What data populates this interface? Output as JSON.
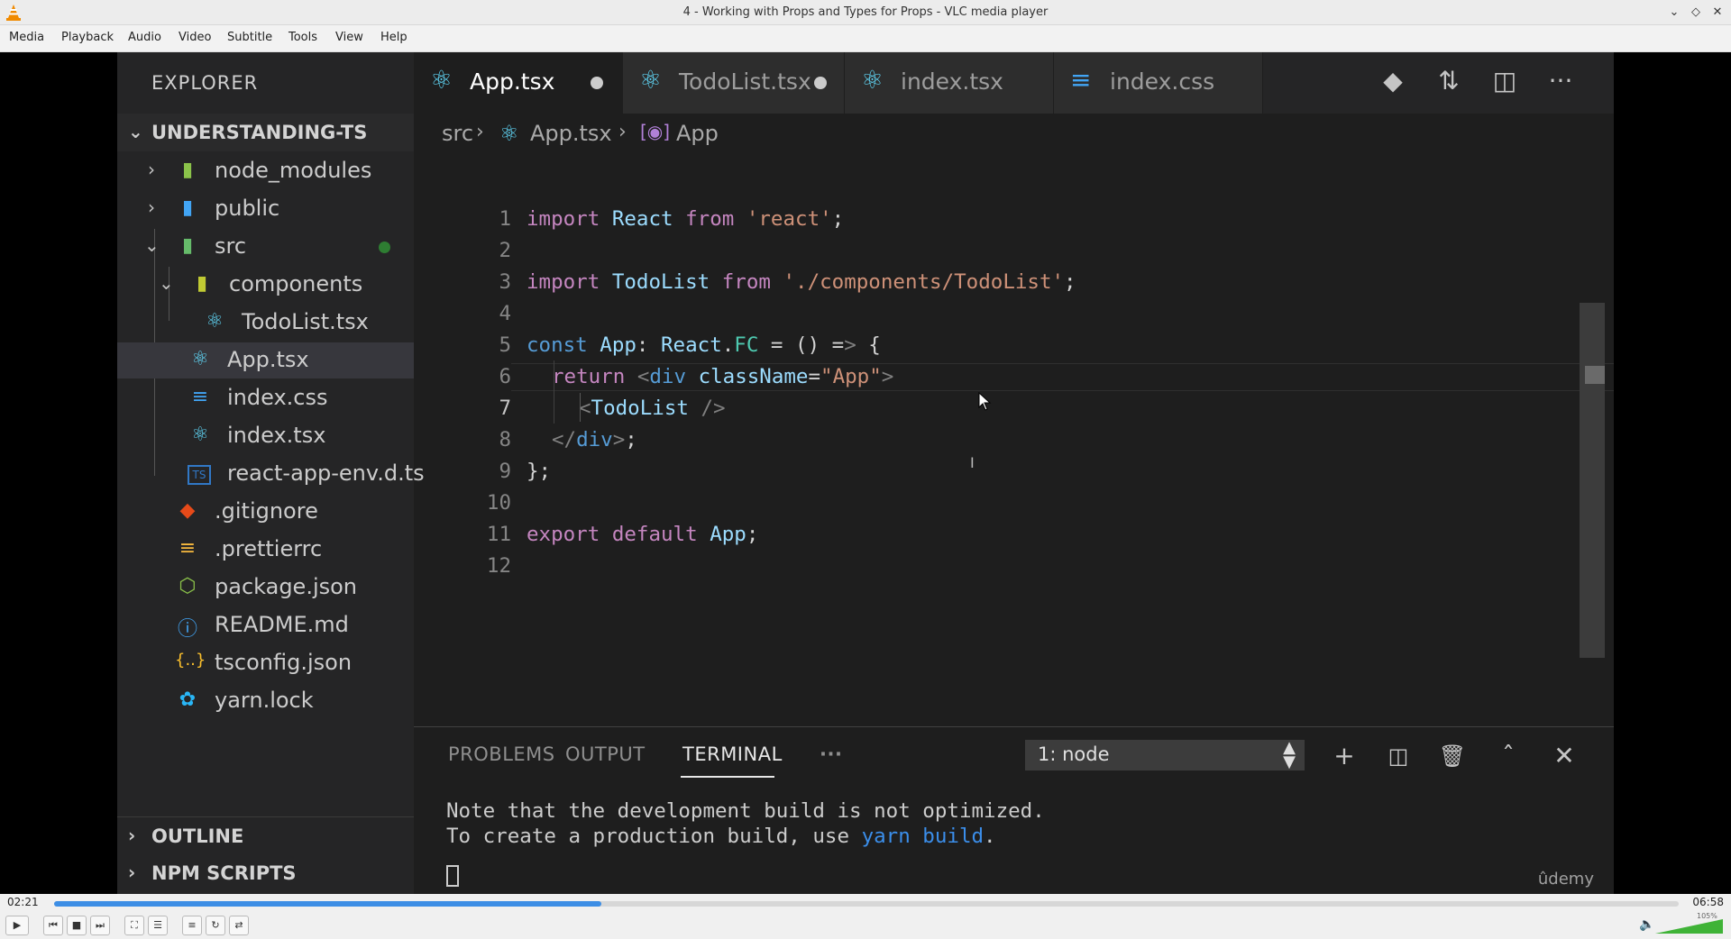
{
  "window": {
    "title": "4 - Working with Props and Types for Props - VLC media player",
    "controls": [
      "minimize-icon",
      "restore-icon",
      "close-icon"
    ]
  },
  "menu": [
    "Media",
    "Playback",
    "Audio",
    "Video",
    "Subtitle",
    "Tools",
    "View",
    "Help"
  ],
  "vscode": {
    "explorer_title": "EXPLORER",
    "project": "UNDERSTANDING-TS",
    "tree": [
      {
        "label": "node_modules",
        "icon": "folder-node-icon"
      },
      {
        "label": "public",
        "icon": "folder-public-icon"
      },
      {
        "label": "src",
        "icon": "folder-src-icon"
      },
      {
        "label": "components",
        "icon": "folder-components-icon"
      },
      {
        "label": "TodoList.tsx",
        "icon": "react-icon"
      },
      {
        "label": "App.tsx",
        "icon": "react-icon"
      },
      {
        "label": "index.css",
        "icon": "css-icon"
      },
      {
        "label": "index.tsx",
        "icon": "react-icon"
      },
      {
        "label": "react-app-env.d.ts",
        "icon": "ts-icon"
      },
      {
        "label": ".gitignore",
        "icon": "git-icon"
      },
      {
        "label": ".prettierrc",
        "icon": "prettier-icon"
      },
      {
        "label": "package.json",
        "icon": "node-icon"
      },
      {
        "label": "README.md",
        "icon": "info-icon"
      },
      {
        "label": "tsconfig.json",
        "icon": "json-icon"
      },
      {
        "label": "yarn.lock",
        "icon": "yarn-icon"
      }
    ],
    "outline": "OUTLINE",
    "npm_scripts": "NPM SCRIPTS",
    "tabs": [
      {
        "label": "App.tsx",
        "modified": true,
        "active": true
      },
      {
        "label": "TodoList.tsx",
        "modified": true,
        "active": false
      },
      {
        "label": "index.tsx",
        "modified": false,
        "active": false
      },
      {
        "label": "index.css",
        "modified": false,
        "active": false
      }
    ],
    "breadcrumb": {
      "folder": "src",
      "file": "App.tsx",
      "symbol": "App"
    },
    "line_numbers": [
      "1",
      "2",
      "3",
      "4",
      "5",
      "6",
      "7",
      "8",
      "9",
      "10",
      "11",
      "12"
    ],
    "code": [
      "import React from 'react';",
      "",
      "import TodoList from './components/TodoList';",
      "",
      "const App: React.FC = () => {",
      "return <div className=\"App\">",
      "<TodoList />",
      "</div>;",
      "};",
      "",
      "export default App;",
      ""
    ],
    "panel": {
      "tabs": [
        "PROBLEMS",
        "OUTPUT",
        "TERMINAL",
        "···"
      ],
      "active_tab": "TERMINAL",
      "terminal_select": "1: node",
      "terminal_lines": [
        "Note that the development build is not optimized.",
        "To create a production build, use ",
        "yarn build",
        "."
      ],
      "watermark": "ûdemy"
    }
  },
  "player": {
    "time_current": "02:21",
    "time_total": "06:58",
    "progress_fraction": 0.337,
    "volume_label": "105%",
    "volume_fraction": 1.0
  }
}
